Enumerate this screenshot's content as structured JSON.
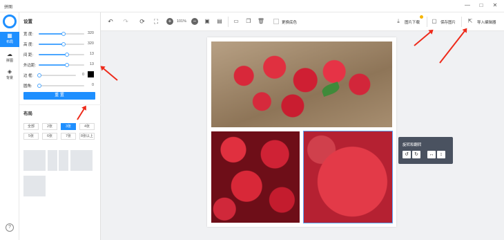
{
  "window": {
    "title": "拼图",
    "controls": [
      "—",
      "□",
      "✕"
    ]
  },
  "iconbar": {
    "items": [
      {
        "label": "布局",
        "icon": "layout-icon"
      },
      {
        "label": "拼图",
        "icon": "cloud-icon"
      },
      {
        "label": "背景",
        "icon": "paint-bucket-icon"
      }
    ],
    "help": "?"
  },
  "settings": {
    "heading": "设置",
    "sliders": [
      {
        "label": "宽 度:",
        "value": "320",
        "fraction": 0.55
      },
      {
        "label": "高 度:",
        "value": "320",
        "fraction": 0.55
      },
      {
        "label": "间 距:",
        "value": "13",
        "fraction": 0.62
      },
      {
        "label": "外边距:",
        "value": "13",
        "fraction": 0.62
      },
      {
        "label": "边 框:",
        "value": "0",
        "fraction": 0.0
      },
      {
        "label": "圆角:",
        "value": "0",
        "fraction": 0.0
      }
    ],
    "border_color": "#000000",
    "reset_label": "重 置"
  },
  "layout": {
    "heading": "布局",
    "buttons": [
      "全部",
      "2张",
      "3张",
      "4张",
      "5张",
      "6张",
      "7张",
      "8张以上"
    ],
    "active_index": 2
  },
  "toolbar": {
    "zoom": "101%",
    "swap_color_label": "更换底色",
    "download_label": "图片下载",
    "save_label": "保存图片",
    "import_label": "导入编辑器"
  },
  "popup": {
    "title": "旋转和翻转",
    "buttons": [
      "↺",
      "↻",
      "↔",
      "↕"
    ]
  },
  "colors": {
    "accent": "#1e8fff",
    "arrow": "#ee2a1a",
    "popup_bg": "#4a5260"
  }
}
